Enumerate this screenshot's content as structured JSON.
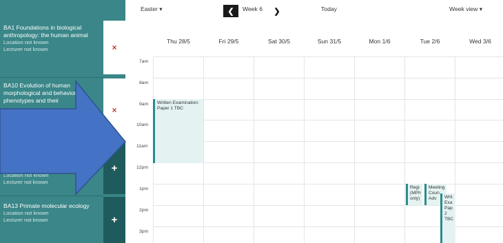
{
  "sidebar": {
    "courses": [
      {
        "title": "BA1 Foundations in biological anthropology: the human animal",
        "location": "Location not known",
        "lecturer": "Lecturer not known",
        "action": "×"
      },
      {
        "title": "BA10 Evolution of human morphological and behavioural phenotypes and their",
        "location": "",
        "lecturer": "",
        "action": "×"
      },
      {
        "title": "",
        "location": "Location not known",
        "lecturer": "Lecturer not known",
        "action": "+"
      },
      {
        "title": "BA13 Primate molecular ecology",
        "location": "Location not known",
        "lecturer": "Lecturer not known",
        "action": "+"
      }
    ]
  },
  "toolbar": {
    "term": "Easter ▾",
    "prev": "❮",
    "week": "Week 6",
    "next": "❯",
    "today": "Today",
    "view": "Week view ▾"
  },
  "days": [
    "Thu 28/5",
    "Fri 29/5",
    "Sat 30/5",
    "Sun 31/5",
    "Mon 1/6",
    "Tue 2/6",
    "Wed 3/6"
  ],
  "hours": [
    "7am",
    "8am",
    "9am",
    "10am",
    "11am",
    "12pm",
    "1pm",
    "2pm",
    "3pm"
  ],
  "events": [
    {
      "text": "Written Examination: Paper 1 TBC"
    },
    {
      "text": "Regi (MPh only)"
    },
    {
      "text": "Meeting Coun Adv"
    },
    {
      "text": "Writ Exa Pap 2 TBC"
    }
  ],
  "overlay": {
    "shape": "arrow",
    "color": "#4472c4"
  },
  "colors": {
    "sidebar": "#3a8688",
    "sidebar_dark": "#1f5b5d",
    "event_bg": "#e4f3f2",
    "event_border": "#2a8a8d",
    "remove": "#c0392b"
  }
}
